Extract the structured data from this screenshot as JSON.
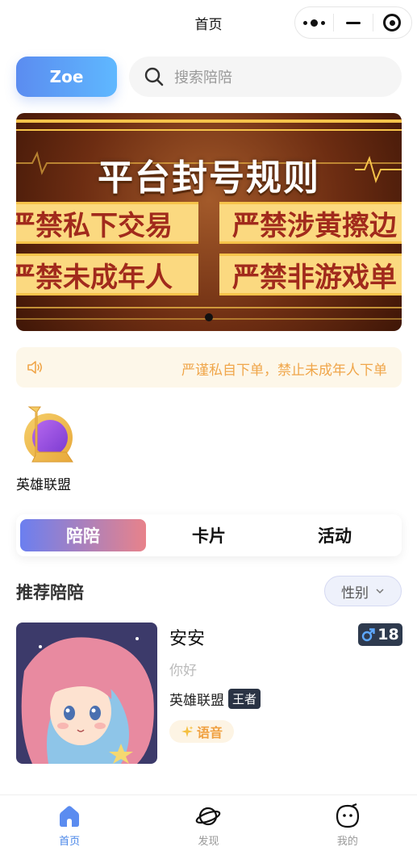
{
  "header": {
    "title": "首页"
  },
  "capsule": {
    "more_icon": "more-dots-icon",
    "minimize_icon": "minimize-icon",
    "close_icon": "target-circle-icon"
  },
  "user": {
    "name": "Zoe"
  },
  "search": {
    "placeholder": "搜索陪陪",
    "icon": "search-icon"
  },
  "banner": {
    "title": "平台封号规则",
    "rules": [
      "严禁私下交易",
      "严禁涉黄擦边",
      "严禁未成年人",
      "严禁非游戏单"
    ],
    "visible_rules": [
      "严禁私下交易",
      "严禁涉黄擦边",
      "严禁未成年人",
      "严禁非游戏单"
    ],
    "page_index": 1,
    "page_count": 1
  },
  "notice": {
    "icon": "speaker-icon",
    "text": "严谨私自下单，禁止未成年人下单"
  },
  "games": [
    {
      "label": "英雄联盟",
      "icon": "league-of-legends-icon"
    }
  ],
  "tabs": [
    {
      "label": "陪陪",
      "active": true
    },
    {
      "label": "卡片",
      "active": false
    },
    {
      "label": "活动",
      "active": false
    }
  ],
  "recommend": {
    "title": "推荐陪陪",
    "filter_label": "性别",
    "cards": [
      {
        "name": "安安",
        "age": "18",
        "gender_icon": "male-icon",
        "bio": "你好",
        "game": "英雄联盟",
        "rank": "王者",
        "tag": "语音",
        "tag_icon": "sparkle-icon"
      }
    ]
  },
  "bottom_nav": [
    {
      "label": "首页",
      "icon": "home-icon",
      "active": true
    },
    {
      "label": "发现",
      "icon": "planet-icon",
      "active": false
    },
    {
      "label": "我的",
      "icon": "face-icon",
      "active": false
    }
  ],
  "colors": {
    "accent": "#4a86e8",
    "notice": "#f0a64a",
    "tab_gradient_start": "#6b7ff0",
    "tab_gradient_end": "#e8828a"
  }
}
